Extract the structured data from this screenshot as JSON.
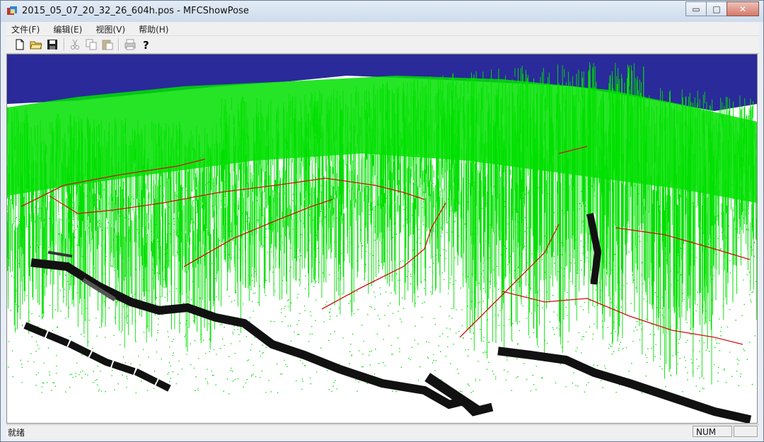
{
  "window": {
    "title": "2015_05_07_20_32_26_604h.pos - MFCShowPose"
  },
  "titlebar_buttons": [
    {
      "name": "minimize",
      "glyph": "▭"
    },
    {
      "name": "maximize",
      "glyph": "□"
    },
    {
      "name": "close",
      "glyph": "✕"
    }
  ],
  "menu": [
    "文件(F)",
    "编辑(E)",
    "视图(V)",
    "帮助(H)"
  ],
  "toolbar": {
    "items": [
      "new-file-icon",
      "open-folder-icon",
      "save-icon",
      "cut-icon",
      "copy-icon",
      "paste-icon",
      "print-icon",
      "help-icon"
    ],
    "disabled": [
      "cut-icon",
      "copy-icon",
      "paste-icon",
      "print-icon"
    ]
  },
  "viewport": {
    "sky_color": "#2a2a9a",
    "point_color": "#00e000",
    "trajectory_color": "#d01010",
    "occupancy_color": "#111111"
  },
  "status": {
    "text": "就绪",
    "num": "NUM"
  }
}
